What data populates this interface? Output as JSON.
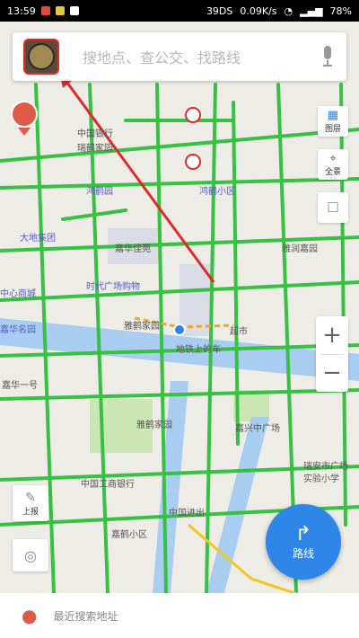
{
  "status_bar": {
    "time": "13:59",
    "speed": "0.09K/s",
    "battery": "78%",
    "network_left": "39DS"
  },
  "search": {
    "placeholder": "搜地点、查公交、找路线"
  },
  "map_labels": {
    "l1": "中国银行",
    "l2": "瑞鹤家园",
    "l3": "鸿鹤园",
    "l4": "鸿鹤小区",
    "l5": "大地集团",
    "l6": "嘉华佳苑",
    "l7": "雅润嘉园",
    "l8": "时代广场购物",
    "l9": "中心商城",
    "l10": "雅鹤家园",
    "l11": "地铁上的车",
    "l12": "超市",
    "l13": "嘉华名园",
    "l14": "嘉华一号",
    "l15": "雅鹤家园",
    "l16": "嘉兴中广场",
    "l17": "中国工商银行",
    "l18": "中国进出",
    "l19": "嘉鹤小区",
    "l20": "瑞安市广场",
    "l21": "实验小学"
  },
  "side_tools": {
    "layers": "图层",
    "location": "全景",
    "report": ""
  },
  "left_tools": {
    "report": "上报",
    "compass": ""
  },
  "route_button": {
    "label": "路线"
  },
  "bottom": {
    "text": "最近搜索地址"
  },
  "colors": {
    "road_green": "#37c142",
    "accent_blue": "#2e86e8",
    "highlight_red": "#e02a2a"
  }
}
